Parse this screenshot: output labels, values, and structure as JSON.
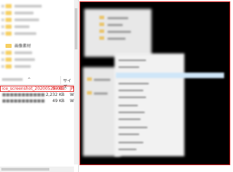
{
  "explorer": {
    "tree_label": "画像素材",
    "columns": {
      "name_sort_icon": "sort-ascending-icon",
      "size": "サイズ"
    },
    "files": [
      {
        "name": "ice_screenshot_20200525-03...",
        "size": "99 KB",
        "type": "JP",
        "selected": true
      },
      {
        "name": "",
        "size": "2,232 KB",
        "type": "W",
        "selected": false
      },
      {
        "name": "",
        "size": "49 KB",
        "type": "W",
        "selected": false
      }
    ]
  },
  "preview": {
    "selection_color": "#e02020",
    "highlight_color": "#cfe6f8"
  }
}
